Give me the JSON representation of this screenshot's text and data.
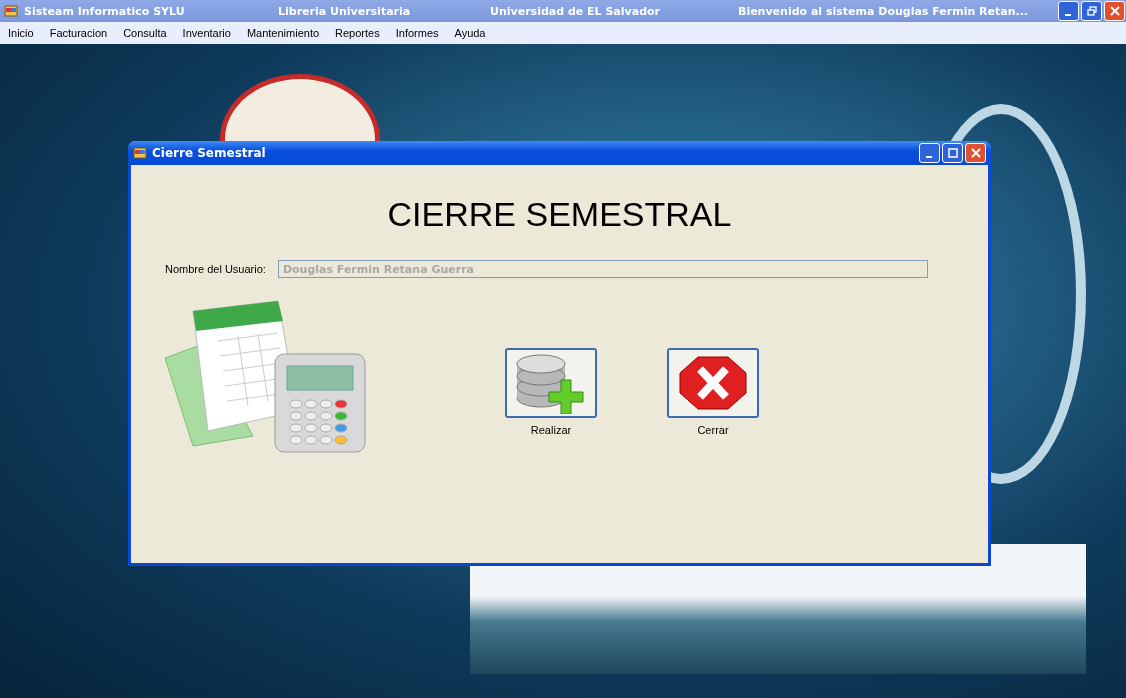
{
  "window": {
    "title_parts": [
      "Sisteam Informatico SYLU",
      "Libreria Universitaria",
      "Universidad de EL Salvador",
      "Bienvenido al sistema Douglas Fermin Retan..."
    ]
  },
  "menu": [
    "Inicio",
    "Facturacion",
    "Consulta",
    "Inventario",
    "Mantenimiento",
    "Reportes",
    "Informes",
    "Ayuda"
  ],
  "dialog": {
    "title": "Cierre Semestral",
    "heading": "CIERRE SEMESTRAL",
    "user_field": {
      "label": "Nombre del Usuario:",
      "value": "Douglas Fermin Retana Guerra",
      "disabled": true
    },
    "buttons": [
      {
        "label": "Realizar",
        "kind": "add-database"
      },
      {
        "label": "Cerrar",
        "kind": "cancel"
      }
    ]
  }
}
